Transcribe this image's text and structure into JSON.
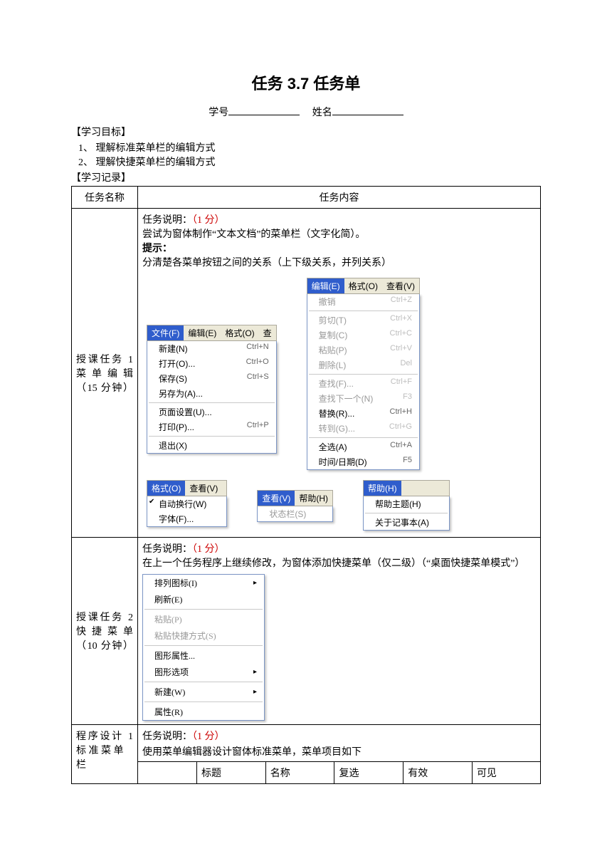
{
  "header": {
    "title": "任务 3.7  任务单",
    "id_label": "学号",
    "name_label": "姓名"
  },
  "goals": {
    "label": "【学习目标】",
    "items": [
      "1、 理解标准菜单栏的编辑方式",
      "2、 理解快捷菜单栏的编辑方式"
    ],
    "record_label": "【学习记录】"
  },
  "table_headers": {
    "col1": "任务名称",
    "col2": "任务内容"
  },
  "task1": {
    "row_label": "授课任务 1\n菜 单 编 辑\n（15 分钟）",
    "desc_prefix": "任务说明：",
    "desc_score": "（1 分）",
    "desc_line2": "尝试为窗体制作“文本文档”的菜单栏（文字化简）。",
    "hint_label": "提示：",
    "hint_text": "分清楚各菜单按钮之间的关系（上下级关系，并列关系）",
    "file_menu": {
      "bar": [
        "文件(F)",
        "编辑(E)",
        "格式(O)",
        "查"
      ],
      "items": [
        [
          "新建(N)",
          "Ctrl+N"
        ],
        [
          "打开(O)...",
          "Ctrl+O"
        ],
        [
          "保存(S)",
          "Ctrl+S"
        ],
        [
          "另存为(A)...",
          ""
        ],
        [
          "---",
          ""
        ],
        [
          "页面设置(U)...",
          ""
        ],
        [
          "打印(P)...",
          "Ctrl+P"
        ],
        [
          "---",
          ""
        ],
        [
          "退出(X)",
          ""
        ]
      ]
    },
    "edit_menu": {
      "bar": [
        "编辑(E)",
        "格式(O)",
        "查看(V)"
      ],
      "items": [
        [
          "撤销",
          "Ctrl+Z",
          "d"
        ],
        [
          "---",
          "",
          ""
        ],
        [
          "剪切(T)",
          "Ctrl+X",
          "d"
        ],
        [
          "复制(C)",
          "Ctrl+C",
          "d"
        ],
        [
          "粘贴(P)",
          "Ctrl+V",
          "d"
        ],
        [
          "删除(L)",
          "Del",
          "d"
        ],
        [
          "---",
          "",
          ""
        ],
        [
          "查找(F)...",
          "Ctrl+F",
          "d"
        ],
        [
          "查找下一个(N)",
          "F3",
          "d"
        ],
        [
          "替换(R)...",
          "Ctrl+H",
          ""
        ],
        [
          "转到(G)...",
          "Ctrl+G",
          "d"
        ],
        [
          "---",
          "",
          ""
        ],
        [
          "全选(A)",
          "Ctrl+A",
          ""
        ],
        [
          "时间/日期(D)",
          "F5",
          ""
        ]
      ]
    },
    "format_menu": {
      "bar": [
        "格式(O)",
        "查看(V)"
      ],
      "items": [
        [
          "自动换行(W)",
          "",
          "chk"
        ],
        [
          "字体(F)...",
          "",
          ""
        ]
      ]
    },
    "view_menu": {
      "bar": [
        "查看(V)",
        "帮助(H)"
      ],
      "items": [
        [
          "状态栏(S)",
          "",
          "d"
        ]
      ]
    },
    "help_menu": {
      "bar": [
        "帮助(H)"
      ],
      "items": [
        [
          "帮助主题(H)",
          "",
          ""
        ],
        [
          "---",
          "",
          ""
        ],
        [
          "关于记事本(A)",
          "",
          ""
        ]
      ]
    }
  },
  "task2": {
    "row_label": "授课任务 2\n快 捷 菜 单\n（10 分钟）",
    "desc_prefix": "任务说明：",
    "desc_score": "（1 分）",
    "desc_text": "在上一个任务程序上继续修改，为窗体添加快捷菜单（仅二级）（“桌面快捷菜单模式”）",
    "context_items": [
      [
        "排列图标(I)",
        "arrow",
        ""
      ],
      [
        "刷新(E)",
        "",
        ""
      ],
      [
        "---",
        "",
        ""
      ],
      [
        "粘贴(P)",
        "",
        "d"
      ],
      [
        "粘贴快捷方式(S)",
        "",
        "d"
      ],
      [
        "---",
        "",
        ""
      ],
      [
        "图形属性...",
        "",
        ""
      ],
      [
        "图形选项",
        "arrow",
        ""
      ],
      [
        "---",
        "",
        ""
      ],
      [
        "新建(W)",
        "arrow",
        ""
      ],
      [
        "---",
        "",
        ""
      ],
      [
        "属性(R)",
        "",
        ""
      ]
    ]
  },
  "task3": {
    "row_label": "程序设计 1\n标 准 菜 单 栏",
    "desc_prefix": "任务说明：",
    "desc_score": "（1 分）",
    "desc_text": "使用菜单编辑器设计窗体标准菜单，菜单项目如下",
    "cols": [
      "",
      "标题",
      "名称",
      "复选",
      "有效",
      "可见"
    ]
  }
}
